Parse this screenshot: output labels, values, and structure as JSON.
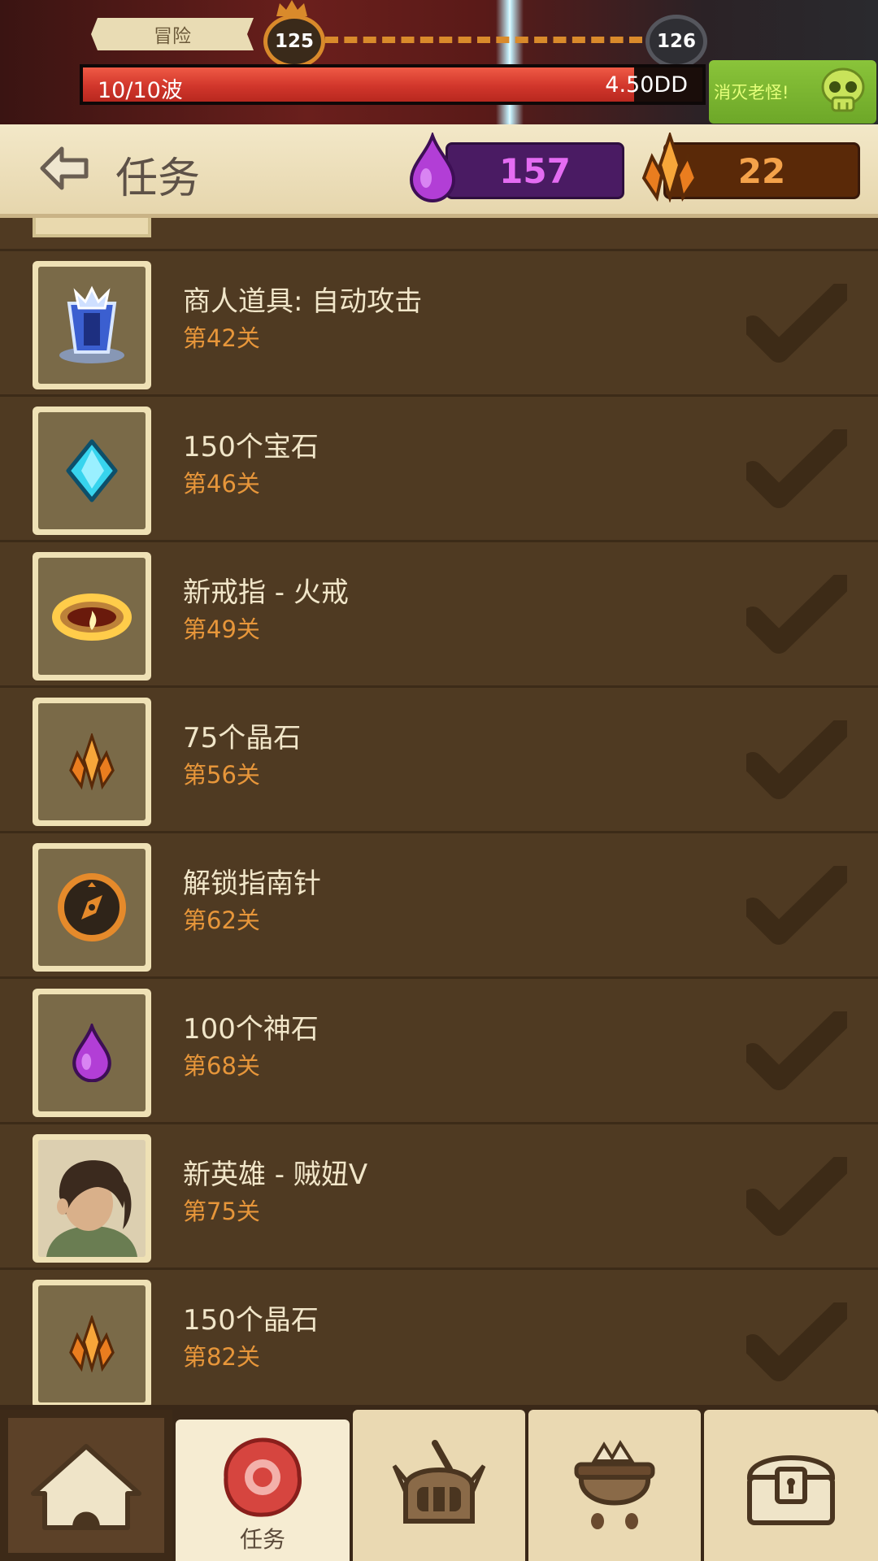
{
  "topbar": {
    "mode_label": "冒险",
    "current_level": "125",
    "next_level": "126",
    "wave_text": "10/10波",
    "wave_progress": 0.89,
    "damage_text": "4.50DD",
    "boss_button_label": "消灭老怪!"
  },
  "header": {
    "title": "任务",
    "gems": "157",
    "crystals": "22"
  },
  "tasks": [
    {
      "title": "商人道具: 自动攻击",
      "level": "第42关",
      "icon": "auto-attack-icon"
    },
    {
      "title": "150个宝石",
      "level": "第46关",
      "icon": "gem-reward-icon"
    },
    {
      "title": "新戒指 - 火戒",
      "level": "第49关",
      "icon": "fire-ring-icon"
    },
    {
      "title": "75个晶石",
      "level": "第56关",
      "icon": "crystal-reward-icon"
    },
    {
      "title": "解锁指南针",
      "level": "第62关",
      "icon": "compass-icon"
    },
    {
      "title": "100个神石",
      "level": "第68关",
      "icon": "divine-stone-icon"
    },
    {
      "title": "新英雄 - 贼妞V",
      "level": "第75关",
      "icon": "hero-portrait-icon"
    },
    {
      "title": "150个晶石",
      "level": "第82关",
      "icon": "crystal-reward-icon"
    }
  ],
  "nav": {
    "tasks_label": "任务"
  },
  "colors": {
    "gem": "#c24be0",
    "crystal": "#f28a25",
    "level_text": "#e7963a"
  }
}
